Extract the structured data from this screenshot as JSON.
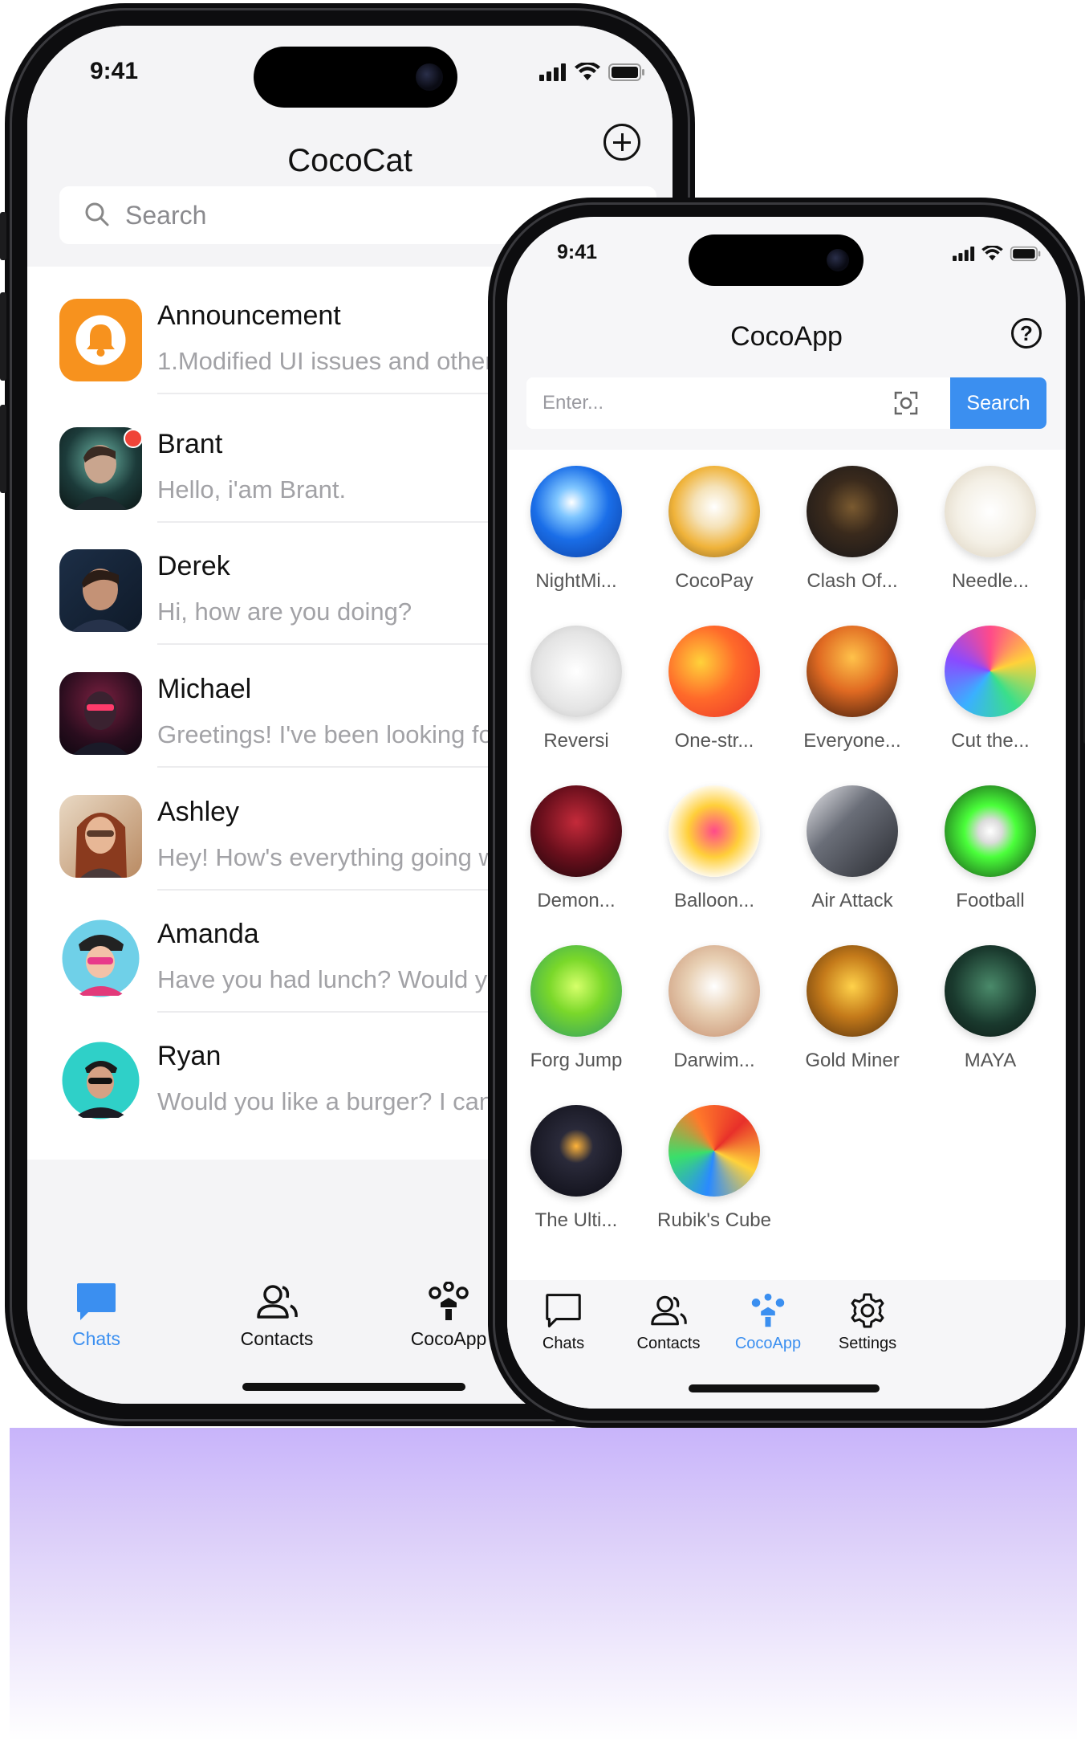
{
  "phone_a": {
    "status_time": "9:41",
    "title": "CocoCat",
    "search": {
      "placeholder": "Search"
    },
    "chats": [
      {
        "name": "Announcement",
        "message": "1.Modified UI issues and other",
        "avatar": "bell-icon",
        "unread": false
      },
      {
        "name": "Brant",
        "message": "Hello, i'am Brant.",
        "avatar": "avatar-brant",
        "unread": true
      },
      {
        "name": "Derek",
        "message": "Hi, how are you doing?",
        "avatar": "avatar-derek",
        "unread": false
      },
      {
        "name": "Michael",
        "message": "Greetings! I've been looking for",
        "avatar": "avatar-michael",
        "unread": false
      },
      {
        "name": "Ashley",
        "message": "Hey! How's everything going wi",
        "avatar": "avatar-ashley",
        "unread": false
      },
      {
        "name": "Amanda",
        "message": "Have you had lunch? Would yo",
        "avatar": "avatar-amanda",
        "unread": false
      },
      {
        "name": "Ryan",
        "message": "Would you like a burger? I can b",
        "avatar": "avatar-ryan",
        "unread": false
      }
    ],
    "tabs": [
      {
        "label": "Chats",
        "icon": "chat-bubble-icon",
        "active": true
      },
      {
        "label": "Contacts",
        "icon": "contacts-icon",
        "active": false
      },
      {
        "label": "CocoApp",
        "icon": "apps-icon",
        "active": false
      }
    ]
  },
  "phone_b": {
    "status_time": "9:41",
    "title": "CocoApp",
    "search": {
      "placeholder": "Enter...",
      "button_label": "Search"
    },
    "apps": [
      {
        "label": "NightMi...",
        "icon": "nightmi-icon"
      },
      {
        "label": "CocoPay",
        "icon": "cocopay-icon"
      },
      {
        "label": "Clash Of...",
        "icon": "clash-icon"
      },
      {
        "label": "Needle...",
        "icon": "thread-needle-icon"
      },
      {
        "label": "Reversi",
        "icon": "reversi-icon"
      },
      {
        "label": "One-str...",
        "icon": "one-stroke-icon"
      },
      {
        "label": "Everyone...",
        "icon": "everyone-icon"
      },
      {
        "label": "Cut the...",
        "icon": "cut-the-icon"
      },
      {
        "label": "Demon...",
        "icon": "demon-icon"
      },
      {
        "label": "Balloon...",
        "icon": "balloon-pop-icon"
      },
      {
        "label": "Air Attack",
        "icon": "air-attack-icon"
      },
      {
        "label": "Football",
        "icon": "football-icon"
      },
      {
        "label": "Forg Jump",
        "icon": "frog-jump-icon"
      },
      {
        "label": "Darwim...",
        "icon": "darwin-icon"
      },
      {
        "label": "Gold Miner",
        "icon": "gold-miner-icon"
      },
      {
        "label": "MAYA",
        "icon": "maya-icon"
      },
      {
        "label": "The Ulti...",
        "icon": "lightbulb-icon"
      },
      {
        "label": "Rubik's Cube",
        "icon": "rubiks-cube-icon"
      }
    ],
    "tabs": [
      {
        "label": "Chats",
        "icon": "chat-bubble-icon",
        "active": false
      },
      {
        "label": "Contacts",
        "icon": "contacts-icon",
        "active": false
      },
      {
        "label": "CocoApp",
        "icon": "apps-icon",
        "active": true
      },
      {
        "label": "Settings",
        "icon": "gear-icon",
        "active": false
      }
    ]
  },
  "colors": {
    "accent": "#3b8ff0",
    "announcement": "#f7921e",
    "unread_dot": "#f04438"
  }
}
